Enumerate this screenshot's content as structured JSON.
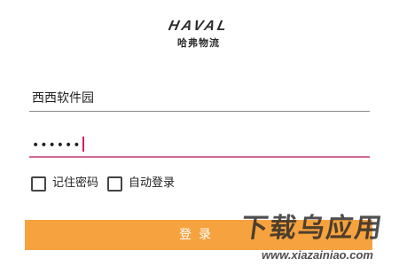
{
  "logo": {
    "wordmark": "HAVAL",
    "subtitle": "哈弗物流"
  },
  "login_form": {
    "username": {
      "value": "西西软件园"
    },
    "password": {
      "masked_value": "••••••",
      "focused": true
    },
    "remember_password": {
      "label": "记住密码",
      "checked": false
    },
    "auto_login": {
      "label": "自动登录",
      "checked": false
    },
    "login_button": {
      "label": "登录"
    }
  },
  "watermark": {
    "text": "下载乌应用",
    "url": "www.xiazainiao.com"
  },
  "colors": {
    "accent_focus": "#d16a92",
    "caret": "#d81b60",
    "button": "#f5a23f",
    "button_text": "#ffffff"
  }
}
